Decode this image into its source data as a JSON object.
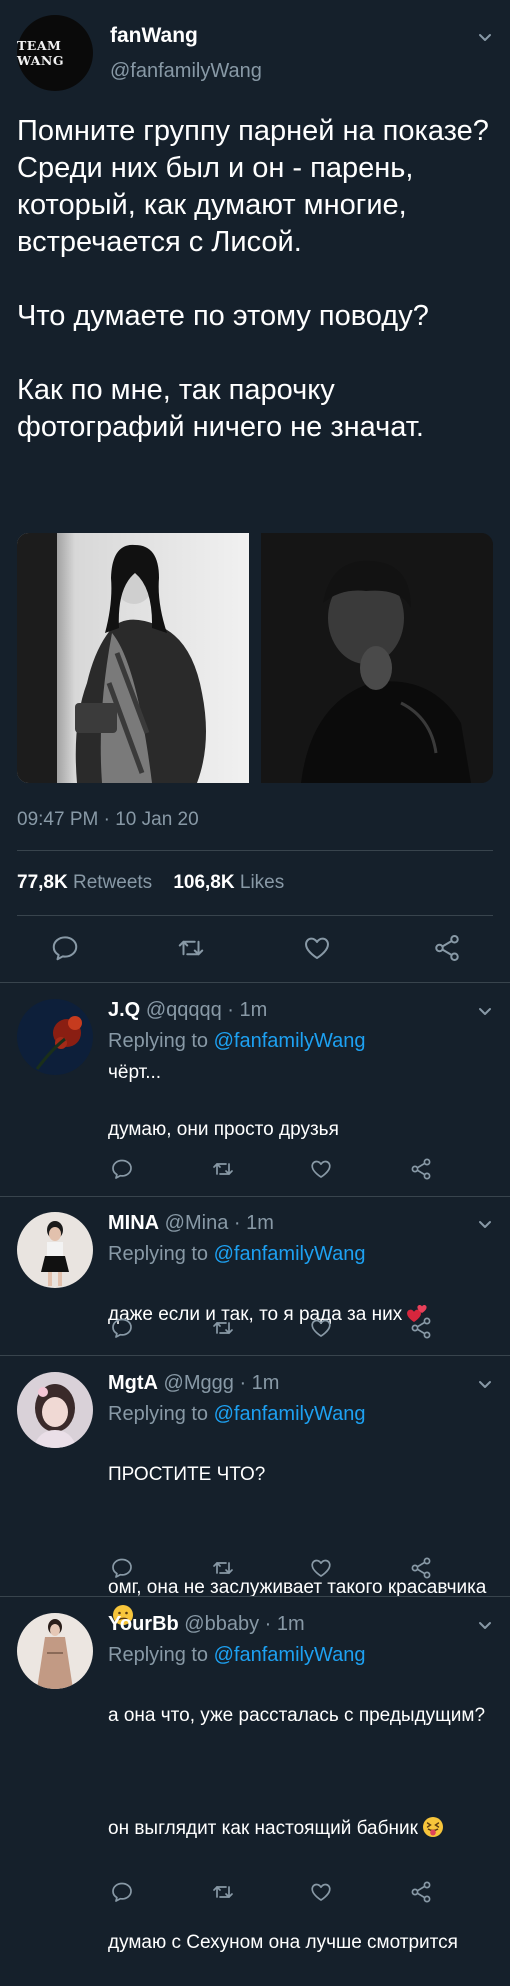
{
  "tweet": {
    "avatar_text": "TEAM WANG",
    "name": "fanWang",
    "handle": "@fanfamilyWang",
    "text": "Помните группу парней на показе?\nСреди них был и он - парень, который, как думают многие, встречается с Лисой.\n\nЧто думаете по этому поводу?\n\nКак по мне, так парочку фотографий ничего не значат.",
    "time": "09:47 PM · 10 Jan 20",
    "retweets_count": "77,8K",
    "retweets_label": "Retweets",
    "likes_count": "106,8K",
    "likes_label": "Likes"
  },
  "icons": {
    "reply": "reply-icon",
    "retweet": "retweet-icon",
    "like": "heart-icon",
    "share": "share-icon",
    "menu": "chevron-down-icon"
  },
  "replies": [
    {
      "name": "J.Q",
      "handle": "@qqqqq",
      "time": "· 1m",
      "replying_prefix": "Replying to",
      "replying_to": "@fanfamilyWang",
      "text": "чёрт...\n\nдумаю, они просто друзья"
    },
    {
      "name": "MINA",
      "handle": "@Mina",
      "time": "· 1m",
      "replying_prefix": "Replying to",
      "replying_to": "@fanfamilyWang",
      "text": "даже если и так, то я рада за них"
    },
    {
      "name": "MgtA",
      "handle": "@Mggg",
      "time": "· 1m",
      "replying_prefix": "Replying to",
      "replying_to": "@fanfamilyWang",
      "text_1": "ПРОСТИТЕ ЧТО?",
      "text_2": "омг, она не заслуживает такого красавчика"
    },
    {
      "name": "YourBb",
      "handle": "@bbaby",
      "time": "· 1m",
      "replying_prefix": "Replying to",
      "replying_to": "@fanfamilyWang",
      "text_1": "а она что, уже рассталась с предыдущим?",
      "text_2": "он выглядит как настоящий бабник",
      "text_3": "думаю с Сехуном она лучше смотрится"
    }
  ],
  "colors": {
    "background": "#15202b",
    "muted": "#8899a6",
    "link": "#1da1f2",
    "divider": "#38444d"
  }
}
